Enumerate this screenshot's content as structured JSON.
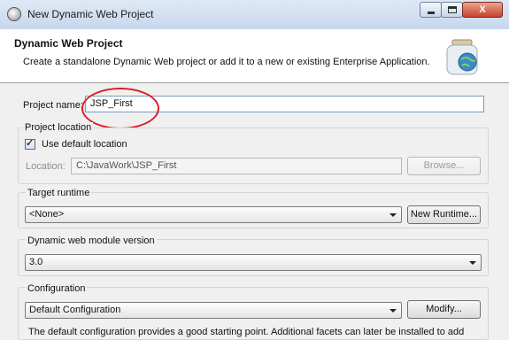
{
  "window": {
    "title": "New Dynamic Web Project",
    "minimize_icon": "minimize-icon",
    "maximize_icon": "maximize-icon",
    "close_glyph": "X"
  },
  "header": {
    "title": "Dynamic Web Project",
    "description": "Create a standalone Dynamic Web project or add it to a new or existing Enterprise Application.",
    "icon": "web-project-jar-icon"
  },
  "project_name": {
    "label": "Project name:",
    "value": "JSP_First"
  },
  "project_location": {
    "group_label": "Project location",
    "use_default_label": "Use default location",
    "use_default_checked": true,
    "location_label": "Location:",
    "location_value": "C:\\JavaWork\\JSP_First",
    "browse_label": "Browse..."
  },
  "target_runtime": {
    "group_label": "Target runtime",
    "selected": "<None>",
    "new_runtime_label": "New Runtime..."
  },
  "module_version": {
    "group_label": "Dynamic web module version",
    "selected": "3.0"
  },
  "configuration": {
    "group_label": "Configuration",
    "selected": "Default Configuration",
    "modify_label": "Modify...",
    "note": "The default configuration provides a good starting point. Additional facets can later be installed to add"
  },
  "colors": {
    "highlight_circle": "#d9202a",
    "titlebar": "#c7d7ec"
  }
}
